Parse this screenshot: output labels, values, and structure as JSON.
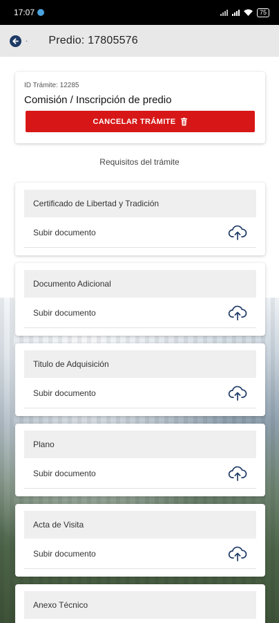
{
  "status_bar": {
    "time": "17:07",
    "battery": "75"
  },
  "app_bar": {
    "title": "Predio: 17805576",
    "back_icon": "arrow-left-circle-icon"
  },
  "tramite": {
    "id_label": "ID Trámite: 12285",
    "name": "Comisión / Inscripción de predio",
    "cancel_label": "CANCELAR TRÁMITE",
    "cancel_icon": "trash-icon"
  },
  "requirements": {
    "title": "Requisitos del trámite",
    "items": [
      {
        "name": "Certificado de Libertad y Tradición",
        "action": "Subir documento"
      },
      {
        "name": "Documento Adicional",
        "action": "Subir documento"
      },
      {
        "name": "Titulo de Adquisición",
        "action": "Subir documento"
      },
      {
        "name": "Plano",
        "action": "Subir documento"
      },
      {
        "name": "Acta de Visita",
        "action": "Subir documento"
      },
      {
        "name": "Anexo Técnico",
        "action": ""
      }
    ]
  },
  "colors": {
    "accent": "#1e3a66",
    "danger": "#d71717"
  }
}
